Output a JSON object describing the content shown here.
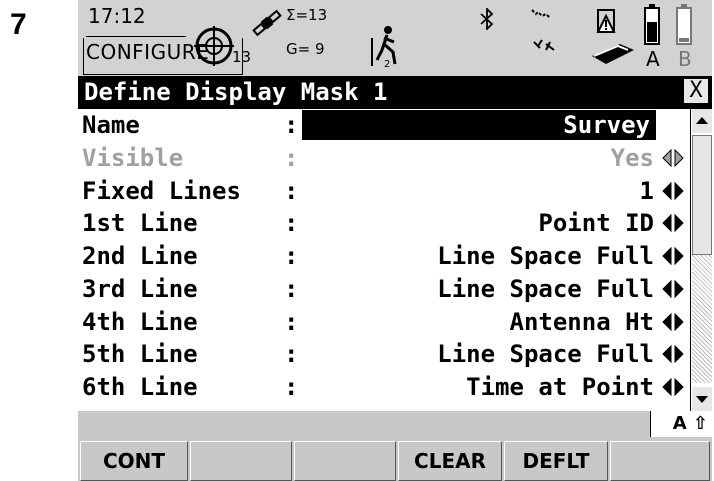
{
  "step_number": "7",
  "status": {
    "time": "17:12",
    "mode": "CONFIGURE",
    "satellites_count": "13",
    "sum_count": "Σ=13",
    "g_count": "G= 9",
    "kbd_indicator": "A",
    "battery_label": "A B"
  },
  "title": "Define Display Mask 1",
  "close_symbol": "X",
  "rows": [
    {
      "label": "Name",
      "value": "Survey",
      "enabled": true
    },
    {
      "label": "Visible",
      "value": "Yes",
      "enabled": false
    },
    {
      "label": "Fixed Lines",
      "value": "1",
      "enabled": true
    },
    {
      "label": "1st Line",
      "value": "Point ID",
      "enabled": true
    },
    {
      "label": "2nd Line",
      "value": "Line Space Full",
      "enabled": true
    },
    {
      "label": "3rd Line",
      "value": "Line Space Full",
      "enabled": true
    },
    {
      "label": "4th Line",
      "value": "Antenna Ht",
      "enabled": true
    },
    {
      "label": "5th Line",
      "value": "Line Space Full",
      "enabled": true
    },
    {
      "label": "6th Line",
      "value": "Time at Point",
      "enabled": true
    }
  ],
  "input_mode": "A ⇧",
  "fkeys": [
    "CONT",
    "",
    "",
    "CLEAR",
    "DEFLT",
    ""
  ]
}
